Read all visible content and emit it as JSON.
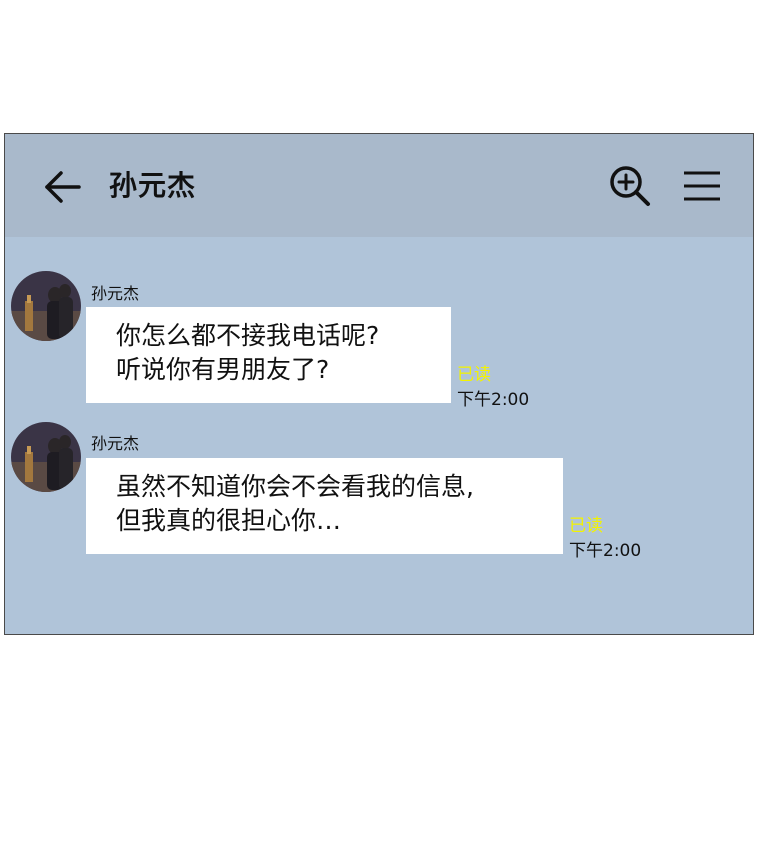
{
  "header": {
    "title": "孙元杰",
    "icons": [
      "back-arrow-icon",
      "zoom-in-icon",
      "menu-icon"
    ]
  },
  "messages": [
    {
      "sender": "孙元杰",
      "lines": [
        "你怎么都不接我电话呢?",
        "听说你有男朋友了?"
      ],
      "read": "已读",
      "time": "下午2:00"
    },
    {
      "sender": "孙元杰",
      "lines": [
        "虽然不知道你会不会看我的信息,",
        "但我真的很担心你…"
      ],
      "read": "已读",
      "time": "下午2:00"
    }
  ],
  "colors": {
    "chat_background": "#b0c4d9",
    "header_background": "#a9b9cb",
    "read_receipt": "#f3f300"
  }
}
